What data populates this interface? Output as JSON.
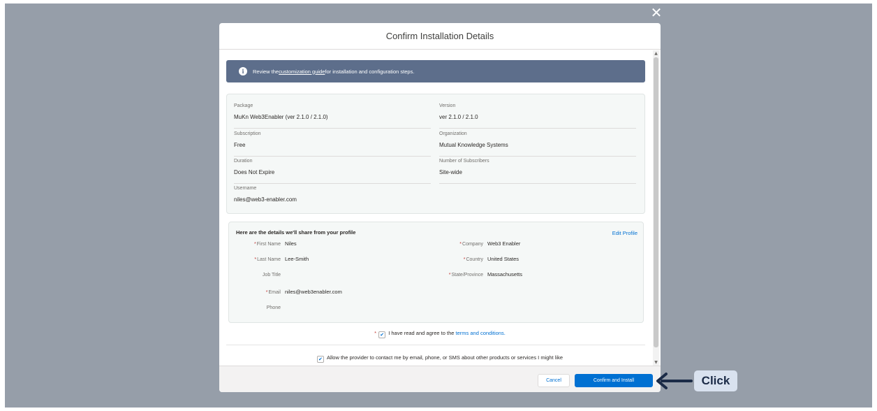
{
  "modal": {
    "title": "Confirm Installation Details",
    "close_glyph": "✕",
    "banner": {
      "icon": "info-icon",
      "text_before": "Review the ",
      "link_text": "customization guide",
      "text_after": " for installation and configuration steps."
    },
    "details": {
      "package_label": "Package",
      "package_value": "MuKn Web3Enabler (ver 2.1.0 / 2.1.0)",
      "version_label": "Version",
      "version_value": "ver 2.1.0 / 2.1.0",
      "subscription_label": "Subscription",
      "subscription_value": "Free",
      "organization_label": "Organization",
      "organization_value": "Mutual Knowledge Systems",
      "duration_label": "Duration",
      "duration_value": "Does Not Expire",
      "subscribers_label": "Number of Subscribers",
      "subscribers_value": "Site-wide",
      "username_label": "Username",
      "username_value": "niles@web3-enabler.com"
    },
    "profile": {
      "title": "Here are the details we'll share from your profile",
      "edit_link": "Edit Profile",
      "required_marker": "*",
      "first_name_label": "First Name",
      "first_name_value": "Niles",
      "last_name_label": "Last Name",
      "last_name_value": "Lee-Smith",
      "job_title_label": "Job Title",
      "job_title_value": "",
      "email_label": "Email",
      "email_value": "niles@web3enabler.com",
      "phone_label": "Phone",
      "phone_value": "",
      "company_label": "Company",
      "company_value": "Web3 Enabler",
      "country_label": "Country",
      "country_value": "United States",
      "state_label": "State/Province",
      "state_value": "Massachusetts"
    },
    "agree": {
      "required_marker": "*",
      "checked": true,
      "text": "I have read and agree to the ",
      "link_text": "terms and conditions."
    },
    "contact": {
      "checked": true,
      "text": "Allow the provider to contact me by email, phone, or SMS about other products or services I might like"
    },
    "footer": {
      "cancel_label": "Cancel",
      "confirm_label": "Confirm and Install"
    }
  },
  "annotation": {
    "label": "Click",
    "arrow_color": "#1b2b47"
  },
  "colors": {
    "backdrop": "#969ea9",
    "banner": "#5d6e8b",
    "primary": "#0070d2"
  }
}
